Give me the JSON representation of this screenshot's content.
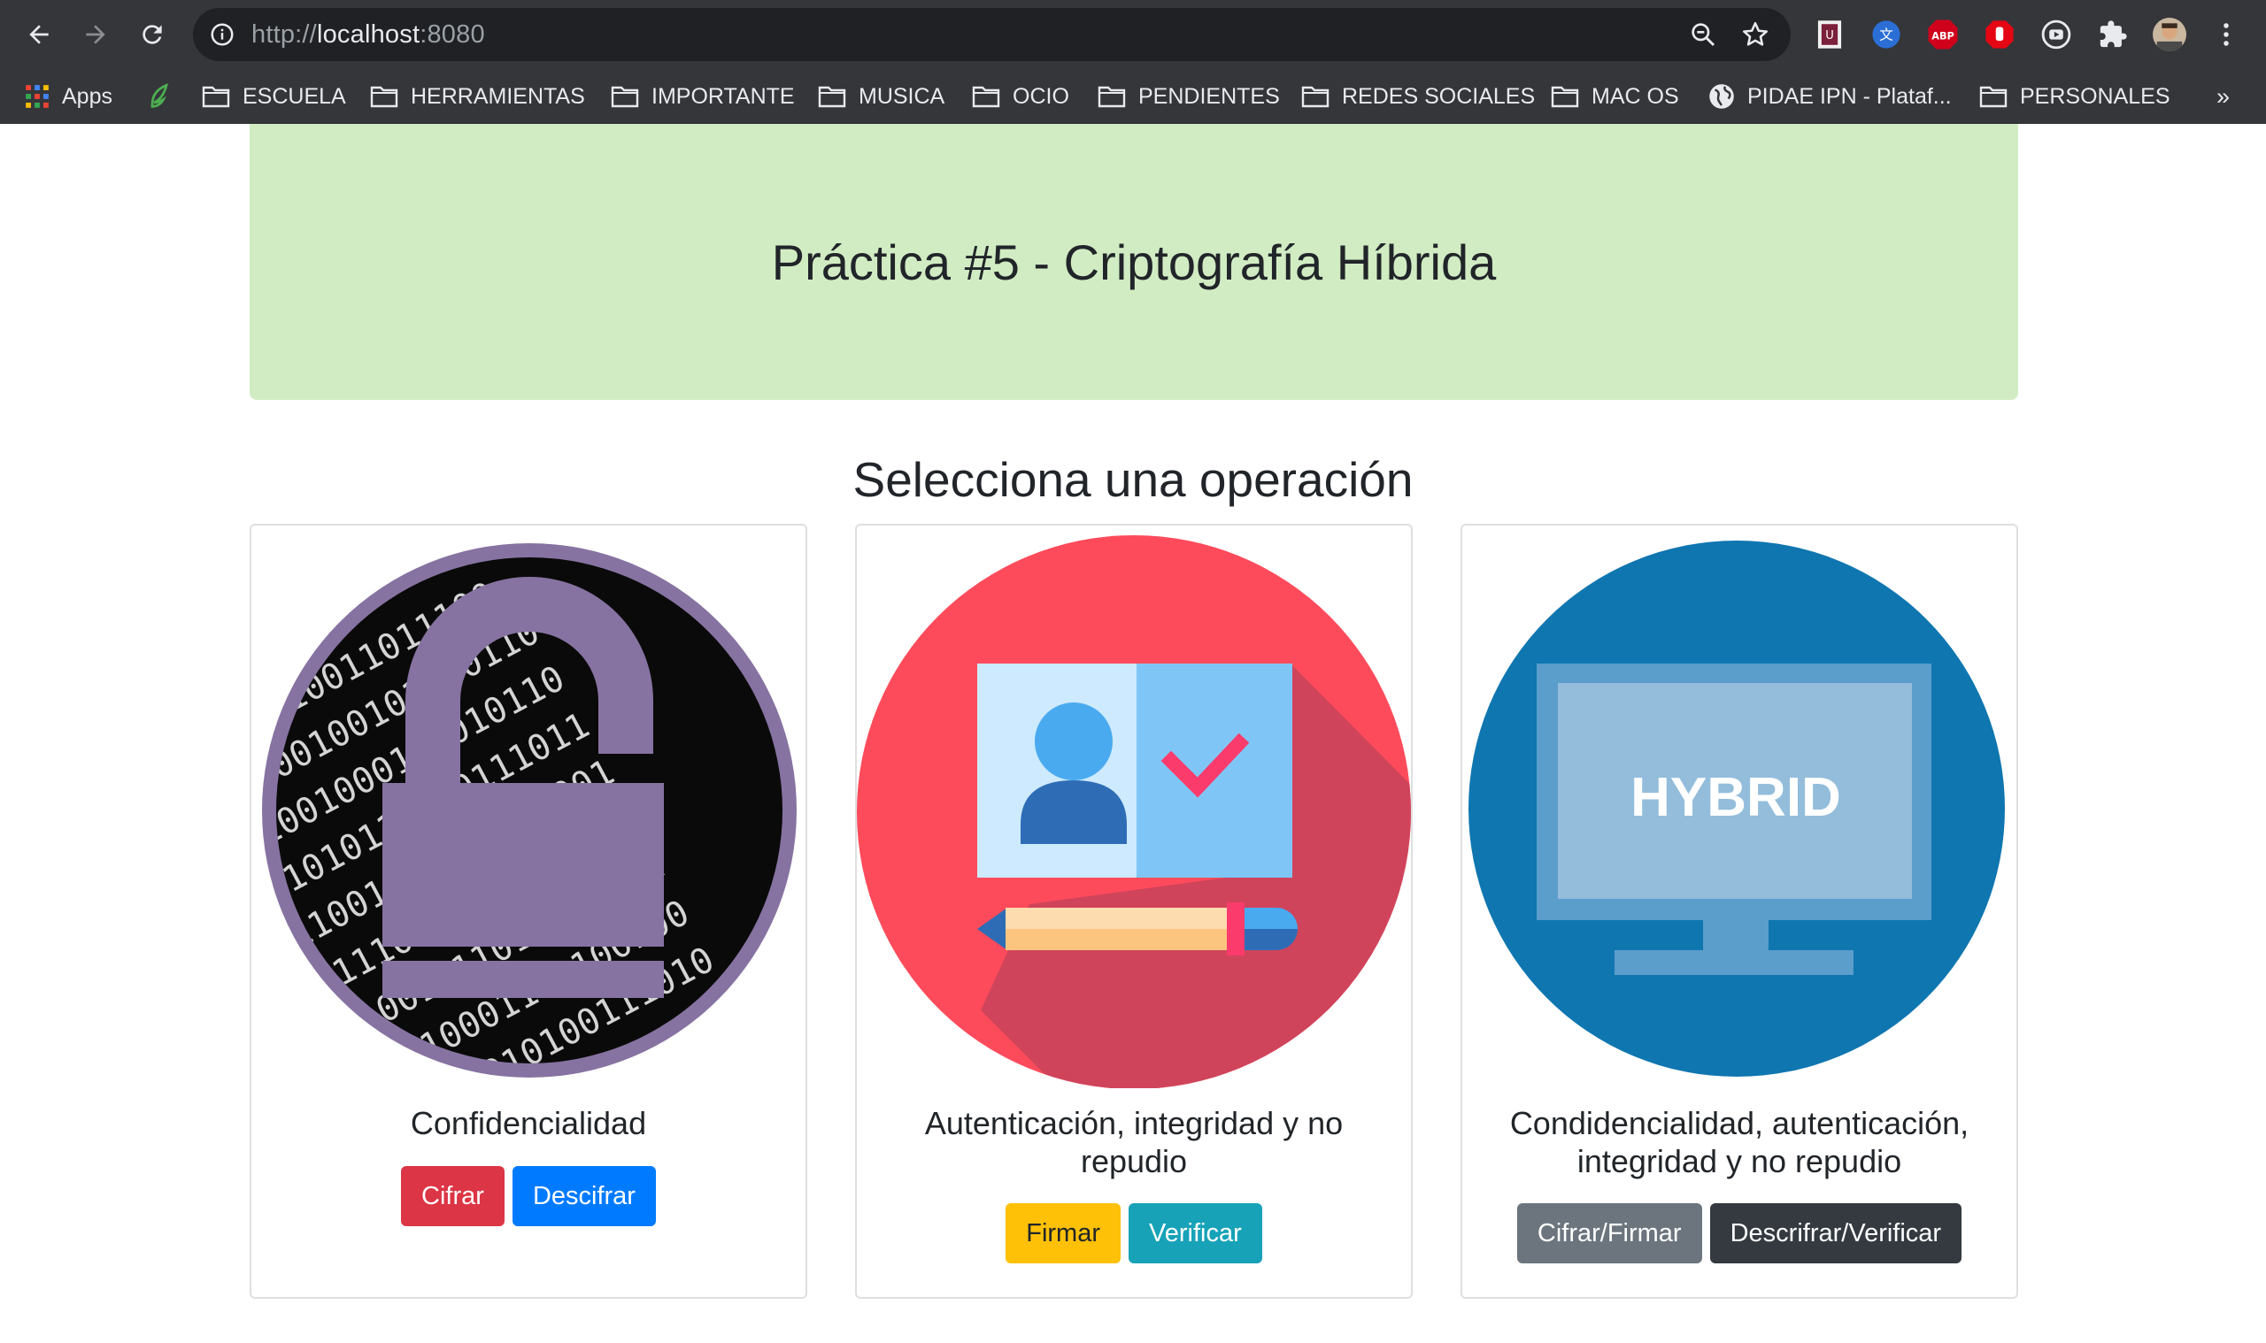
{
  "browser": {
    "url_scheme": "http://",
    "url_host": "localhost",
    "url_port": ":8080",
    "bookmarks": [
      {
        "label": "Apps",
        "icon": "apps-grid-icon"
      },
      {
        "label": "",
        "icon": "evernote-leaf-icon"
      },
      {
        "label": "ESCUELA",
        "icon": "folder-icon"
      },
      {
        "label": "HERRAMIENTAS",
        "icon": "folder-icon"
      },
      {
        "label": "IMPORTANTE",
        "icon": "folder-icon"
      },
      {
        "label": "MUSICA",
        "icon": "folder-icon"
      },
      {
        "label": "OCIO",
        "icon": "folder-icon"
      },
      {
        "label": "PENDIENTES",
        "icon": "folder-icon"
      },
      {
        "label": "REDES SOCIALES",
        "icon": "folder-icon"
      },
      {
        "label": "MAC OS",
        "icon": "folder-icon"
      },
      {
        "label": "PIDAE IPN - Plataf...",
        "icon": "globe-icon"
      },
      {
        "label": "PERSONALES",
        "icon": "folder-icon"
      }
    ],
    "overflow": "»",
    "extensions": {
      "abp": "ABP"
    }
  },
  "page": {
    "heading": "Práctica #5 - Criptografía Híbrida",
    "subtitle": "Selecciona una operación",
    "cards": [
      {
        "title": "Confidencialidad",
        "buttons": [
          "Cifrar",
          "Descifrar"
        ]
      },
      {
        "title": "Autenticación, integridad y no repudio",
        "buttons": [
          "Firmar",
          "Verificar"
        ]
      },
      {
        "title": "Condidencialidad, autenticación, integridad y no repudio",
        "buttons": [
          "Cifrar/Firmar",
          "Descrifrar/Verificar"
        ]
      }
    ],
    "hybrid_image_text": "HYBRID"
  },
  "colors": {
    "jumbotron": "#d1ecc3",
    "danger": "#dc3545",
    "primary": "#007bff",
    "warning": "#ffc107",
    "info": "#17a2b8",
    "secondary": "#6c757d",
    "dark": "#343a40"
  }
}
